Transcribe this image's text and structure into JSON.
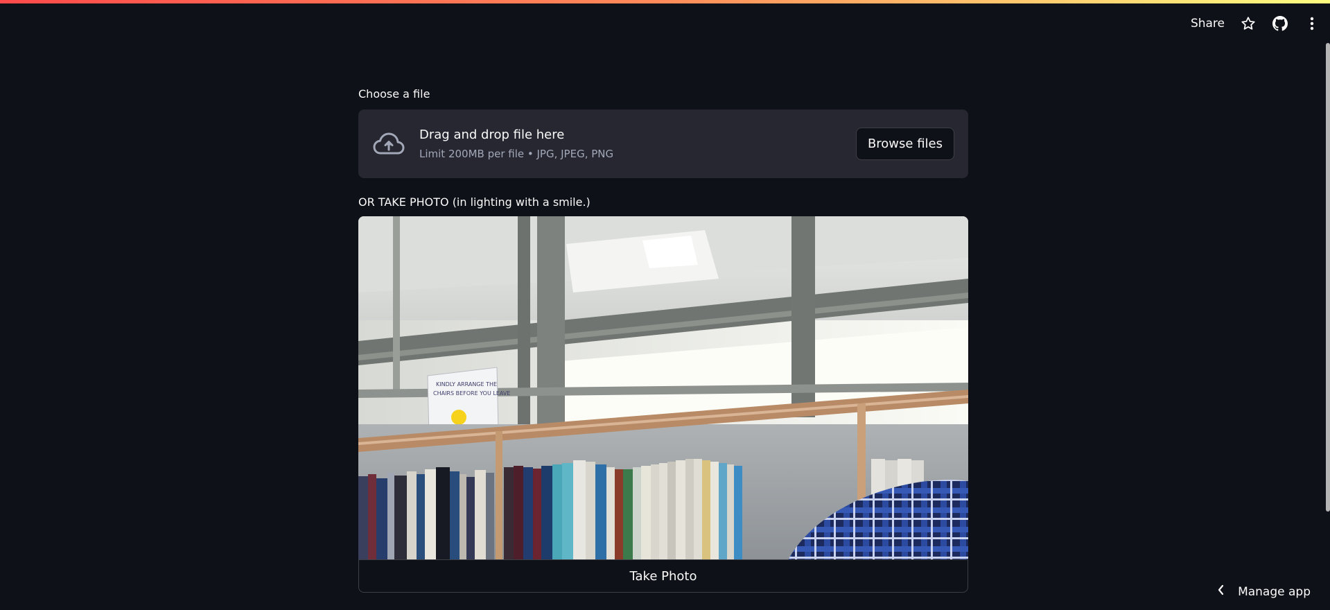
{
  "header": {
    "share_label": "Share",
    "icons": [
      "star-icon",
      "github-icon",
      "more-vertical-icon"
    ]
  },
  "file_uploader": {
    "label": "Choose a file",
    "drop_text": "Drag and drop file here",
    "limit_text": "Limit 200MB per file • JPG, JPEG, PNG",
    "browse_label": "Browse files",
    "icon": "cloud-upload-icon"
  },
  "camera_input": {
    "label": "OR TAKE PHOTO (in lighting with a smile.)",
    "button_label": "Take Photo",
    "sign_text_1": "KINDLY ARRANGE THE",
    "sign_text_2": "CHAIRS BEFORE YOU LEAVE"
  },
  "footer": {
    "manage_label": "Manage app",
    "icon": "chevron-left-icon"
  },
  "colors": {
    "background": "#0e1117",
    "surface": "#262730",
    "text": "#fafafa",
    "muted": "#a3a8b8",
    "accent_gradient_start": "#ff4b4b",
    "accent_gradient_end": "#fffd80"
  }
}
